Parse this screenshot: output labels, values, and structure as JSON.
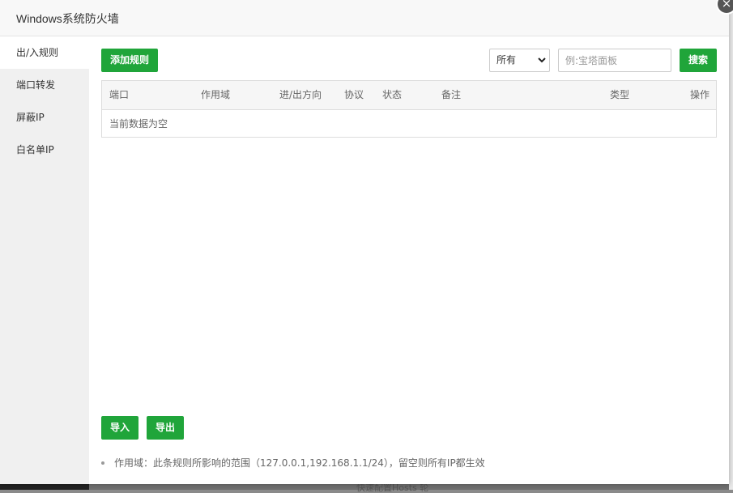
{
  "dialog": {
    "title": "Windows系统防火墙",
    "close_label": "×"
  },
  "sidebar": {
    "items": [
      {
        "label": "出/入规则",
        "active": true
      },
      {
        "label": "端口转发",
        "active": false
      },
      {
        "label": "屏蔽IP",
        "active": false
      },
      {
        "label": "白名单IP",
        "active": false
      }
    ]
  },
  "toolbar": {
    "add_label": "添加规则",
    "filter_value": "所有",
    "search_placeholder": "例:宝塔面板",
    "search_label": "搜索"
  },
  "table": {
    "columns": [
      "端口",
      "作用域",
      "进/出方向",
      "协议",
      "状态",
      "备注",
      "类型",
      "操作"
    ],
    "empty_text": "当前数据为空"
  },
  "footer": {
    "import_label": "导入",
    "export_label": "导出",
    "tip": "作用域：此条规则所影响的范围（127.0.0.1,192.168.1.1/24），留空则所有IP都生效"
  },
  "background": {
    "partial_text": "快速配置Hosts 轮"
  },
  "colors": {
    "accent": "#20a53a"
  }
}
